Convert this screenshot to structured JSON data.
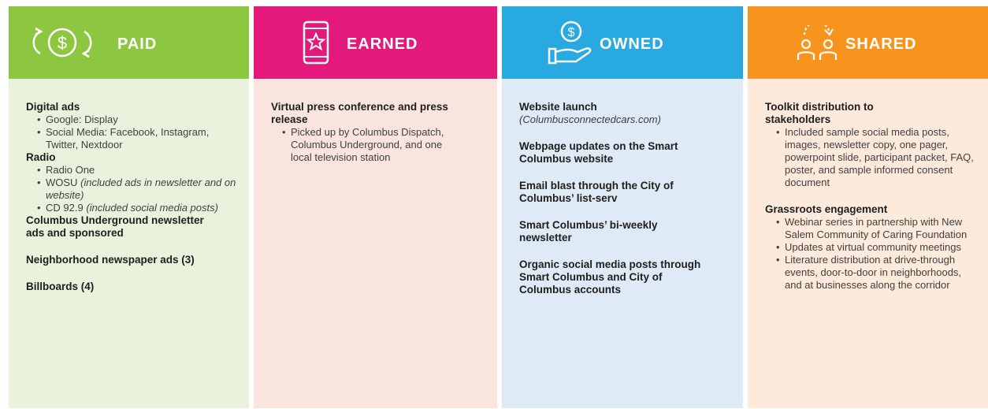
{
  "colors": {
    "paid_header": "#8dc63f",
    "paid_body": "#e9f2dc",
    "earned_header": "#e3197b",
    "earned_body": "#f9e5de",
    "owned_header": "#29a9e1",
    "owned_body": "#deebf7",
    "shared_header": "#f7941d",
    "shared_body": "#fdeadb"
  },
  "columns": [
    {
      "title": "PAID",
      "icon": "dollar-cycle-icon",
      "sections": [
        {
          "heading": "Digital ads",
          "bullets": [
            {
              "text": "Google: Display",
              "note": ""
            },
            {
              "text": "Social Media: Facebook, Instagram, Twitter, Nextdoor",
              "note": ""
            }
          ]
        },
        {
          "heading": "Radio",
          "bullets": [
            {
              "text": "Radio One",
              "note": ""
            },
            {
              "text": "WOSU ",
              "note": "(included ads in newsletter and on website)"
            },
            {
              "text": "CD 92.9 ",
              "note": "(included social media posts)"
            }
          ]
        },
        {
          "heading": "Columbus Underground newsletter ads and sponsored",
          "bullets": []
        },
        {
          "heading": "Neighborhood newspaper ads (3)",
          "bullets": []
        },
        {
          "heading": "Billboards (4)",
          "bullets": []
        }
      ]
    },
    {
      "title": "EARNED",
      "icon": "phone-star-icon",
      "sections": [
        {
          "heading": "Virtual press conference and press release",
          "bullets": [
            {
              "text": "Picked up by Columbus Dispatch, Columbus Underground, and one local television station",
              "note": ""
            }
          ]
        }
      ]
    },
    {
      "title": "OWNED",
      "icon": "hand-coin-icon",
      "sections": [
        {
          "heading": "Website launch",
          "sub": "(Columbusconnectedcars.com)"
        },
        {
          "heading": "Webpage updates on the Smart Columbus website"
        },
        {
          "heading": "Email blast through the City of Columbus’ list-serv"
        },
        {
          "heading": "Smart Columbus’ bi-weekly newsletter"
        },
        {
          "heading": "Organic social media posts through Smart Columbus and City of Columbus accounts"
        }
      ]
    },
    {
      "title": "SHARED",
      "icon": "people-exchange-icon",
      "sections": [
        {
          "heading": "Toolkit distribution to stakeholders",
          "bullets": [
            {
              "text": "Included sample social media posts, images, newsletter copy, one pager, powerpoint slide, participant packet, FAQ, poster, and sample informed consent document",
              "note": ""
            }
          ]
        },
        {
          "heading": "Grassroots engagement",
          "bullets": [
            {
              "text": "Webinar series in partnership with New Salem Community of Caring Foundation",
              "note": ""
            },
            {
              "text": "Updates at virtual community meetings",
              "note": ""
            },
            {
              "text": "Literature distribution at drive-through events, door-to-door in neighborhoods, and at businesses along the corridor",
              "note": ""
            }
          ]
        }
      ]
    }
  ]
}
